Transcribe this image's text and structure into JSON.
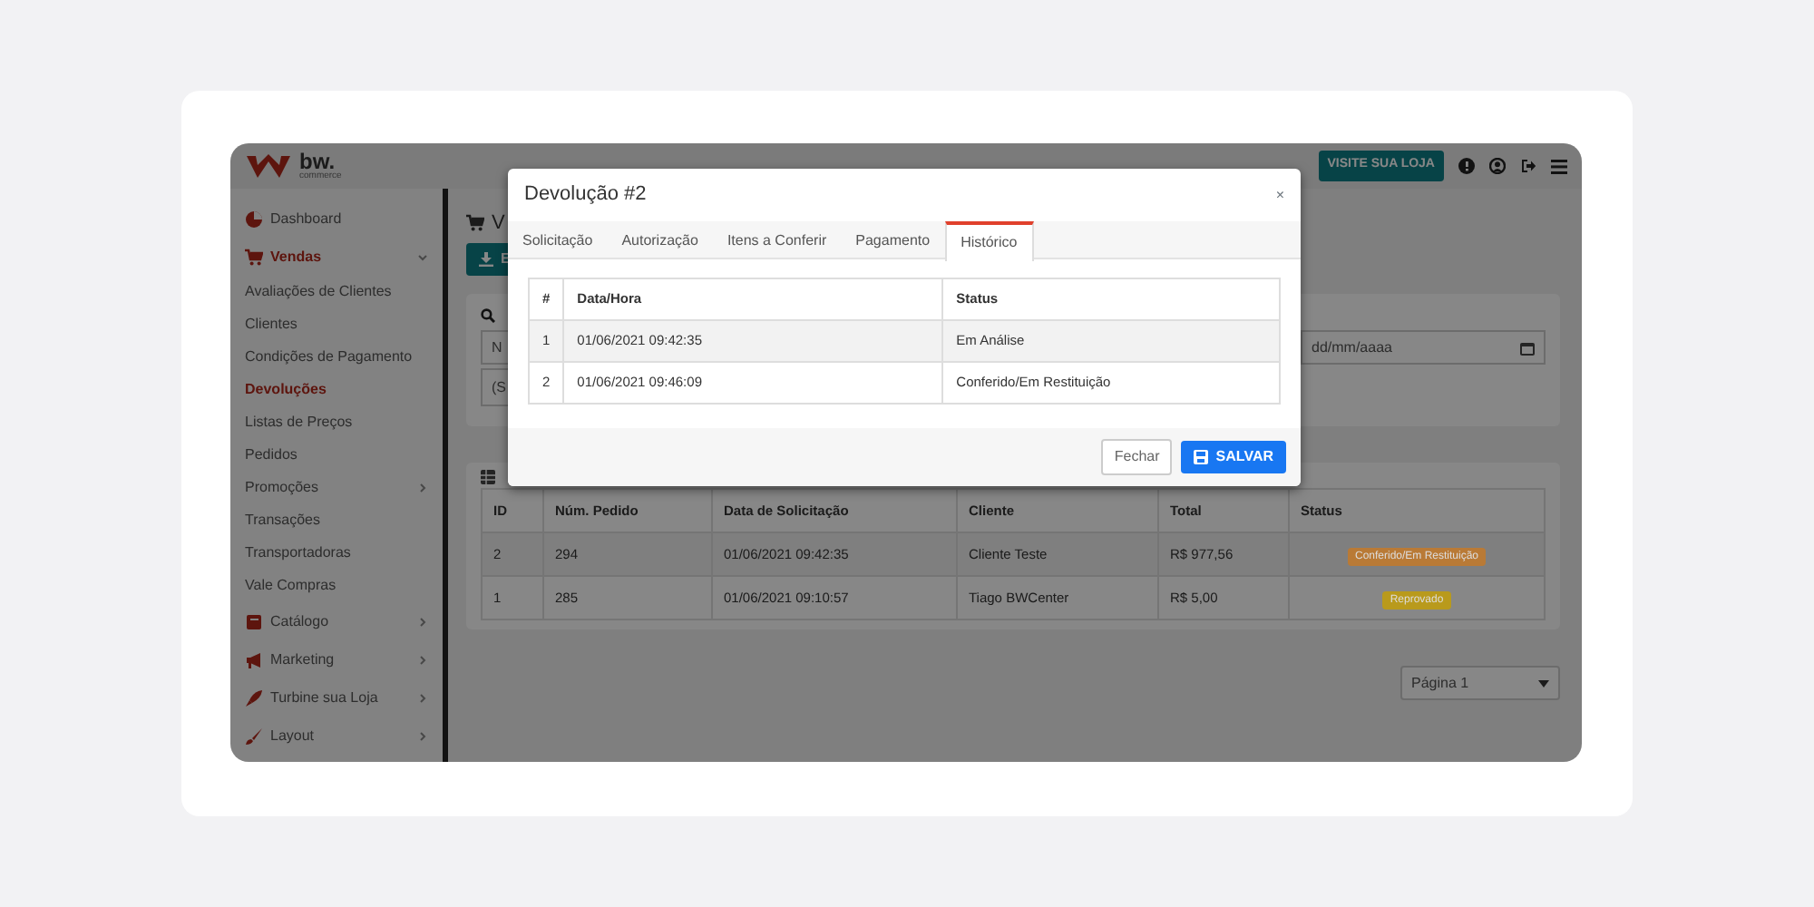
{
  "topbar": {
    "logo_text": "bw.",
    "logo_subtext": "commerce",
    "visit_button": "VISITE SUA LOJA"
  },
  "sidebar": {
    "items": [
      {
        "label": "Dashboard",
        "kind": "link",
        "selected": false
      },
      {
        "label": "Vendas",
        "kind": "group",
        "expanded": true,
        "selected": true,
        "children": [
          {
            "label": "Avaliações de Clientes",
            "selected": false
          },
          {
            "label": "Clientes",
            "selected": false
          },
          {
            "label": "Condições de Pagamento",
            "selected": false
          },
          {
            "label": "Devoluções",
            "selected": true
          },
          {
            "label": "Listas de Preços",
            "selected": false
          },
          {
            "label": "Pedidos",
            "selected": false
          },
          {
            "label": "Promoções",
            "selected": false,
            "has_submenu": true
          },
          {
            "label": "Transações",
            "selected": false
          },
          {
            "label": "Transportadoras",
            "selected": false
          },
          {
            "label": "Vale Compras",
            "selected": false
          }
        ]
      },
      {
        "label": "Catálogo",
        "kind": "group",
        "expanded": false,
        "selected": false
      },
      {
        "label": "Marketing",
        "kind": "group",
        "expanded": false,
        "selected": false
      },
      {
        "label": "Turbine sua Loja",
        "kind": "group",
        "expanded": false,
        "selected": false
      },
      {
        "label": "Layout",
        "kind": "group",
        "expanded": false,
        "selected": false
      }
    ]
  },
  "page": {
    "title": "V",
    "export_button": "E",
    "filter": {
      "field_1": "N",
      "field_2": "(S",
      "date_placeholder": "dd/mm/aaaa"
    },
    "table": {
      "columns": [
        "ID",
        "Núm. Pedido",
        "Data de Solicitação",
        "Cliente",
        "Total",
        "Status"
      ],
      "rows": [
        {
          "cells": [
            "2",
            "294",
            "01/06/2021 09:42:35",
            "Cliente Teste",
            "R$ 977,56"
          ],
          "status": "Conferido/Em Restituição",
          "color": "#b97a36"
        },
        {
          "cells": [
            "1",
            "285",
            "01/06/2021 09:10:57",
            "Tiago BWCenter",
            "R$ 5,00"
          ],
          "status": "Reprovado",
          "color": "#b99a1c"
        }
      ]
    },
    "pagination": {
      "value": "Página 1"
    }
  },
  "modal": {
    "title": "Devolução #2",
    "close": "×",
    "tabs": [
      {
        "label": "Solicitação",
        "selected": false
      },
      {
        "label": "Autorização",
        "selected": false
      },
      {
        "label": "Itens a Conferir",
        "selected": false
      },
      {
        "label": "Pagamento",
        "selected": false
      },
      {
        "label": "Histórico",
        "selected": true
      }
    ],
    "history": {
      "columns": [
        "#",
        "Data/Hora",
        "Status"
      ],
      "rows": [
        [
          "1",
          "01/06/2021 09:42:35",
          "Em Análise"
        ],
        [
          "2",
          "01/06/2021 09:46:09",
          "Conferido/Em Restituição"
        ]
      ]
    },
    "buttons": {
      "close": "Fechar",
      "save": "SALVAR"
    }
  }
}
